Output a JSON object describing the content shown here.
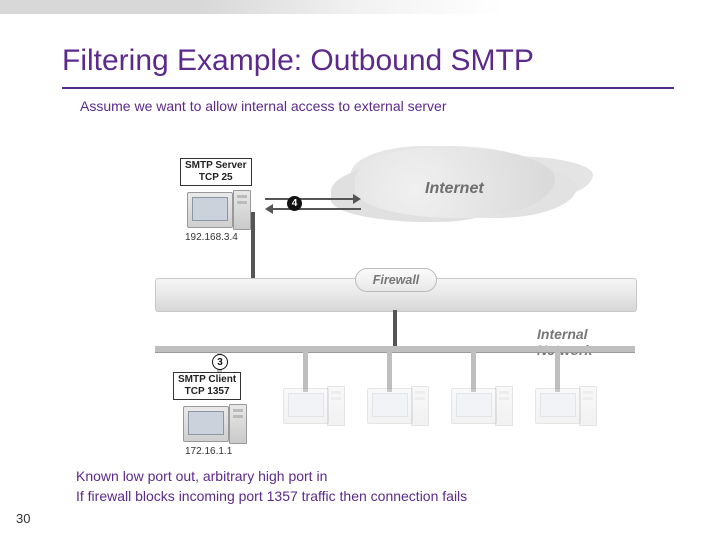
{
  "slide": {
    "title": "Filtering Example: Outbound SMTP",
    "subtitle": "Assume we want to allow internal access to external server",
    "footer_line1": "Known low port out, arbitrary high port in",
    "footer_line2": "If firewall blocks incoming port 1357 traffic then connection fails",
    "page_number": "30"
  },
  "diagram": {
    "cloud_label": "Internet",
    "firewall_label": "Firewall",
    "internal_network_label": "Internal Network",
    "server": {
      "box_line1": "SMTP Server",
      "box_line2": "TCP 25",
      "ip": "192.168.3.4"
    },
    "client": {
      "box_line1": "SMTP Client",
      "box_line2": "TCP 1357",
      "ip": "172.16.1.1"
    },
    "marker_server": "4",
    "marker_client": "3"
  }
}
